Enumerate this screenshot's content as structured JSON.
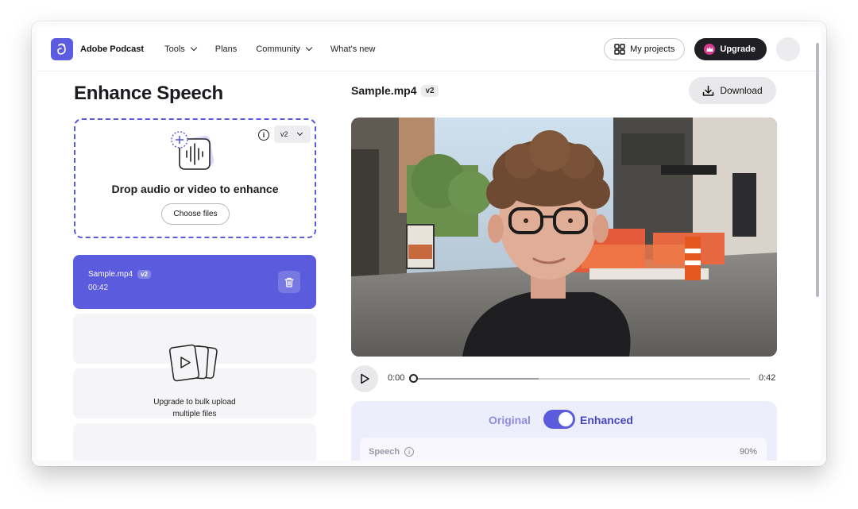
{
  "header": {
    "brand": "Adobe Podcast",
    "nav": [
      {
        "label": "Tools",
        "dropdown": true
      },
      {
        "label": "Plans",
        "dropdown": false
      },
      {
        "label": "Community",
        "dropdown": true
      },
      {
        "label": "What's new",
        "dropdown": false
      }
    ],
    "my_projects": "My projects",
    "upgrade": "Upgrade"
  },
  "left": {
    "title": "Enhance Speech",
    "dropzone": {
      "version": "v2",
      "prompt": "Drop audio or video to enhance",
      "choose_files": "Choose files"
    },
    "file": {
      "name": "Sample.mp4",
      "version": "v2",
      "duration": "00:42"
    },
    "bulk": {
      "line1": "Upgrade to bulk upload",
      "line2": "multiple files"
    }
  },
  "right": {
    "file_title": "Sample.mp4",
    "file_version": "v2",
    "download": "Download",
    "player": {
      "current": "0:00",
      "total": "0:42",
      "buffered_fraction": 0.37,
      "played_fraction": 0.0
    },
    "enhance": {
      "original_label": "Original",
      "enhanced_label": "Enhanced",
      "toggle_on": true,
      "speech_label": "Speech",
      "speech_value": "90%"
    }
  },
  "colors": {
    "accent": "#5b5bdd",
    "upgrade_bg": "#1f1f24",
    "panel_bg": "#eceefb"
  }
}
